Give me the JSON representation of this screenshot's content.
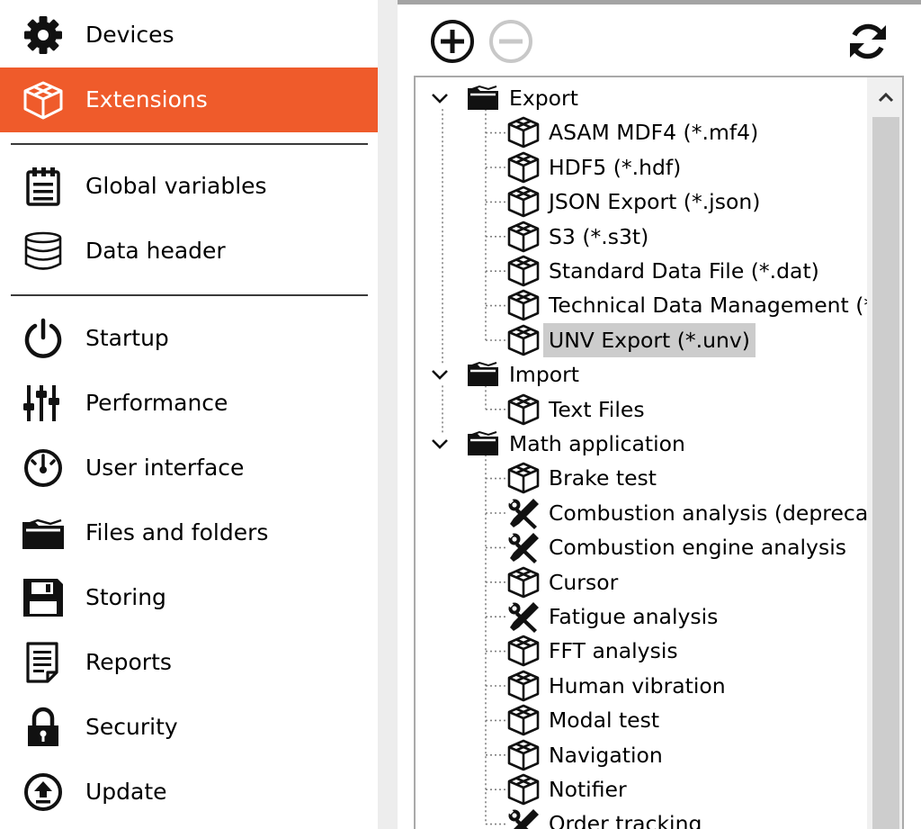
{
  "sidebar": {
    "items": [
      {
        "label": "Devices",
        "icon": "gear-icon"
      },
      {
        "label": "Extensions",
        "icon": "package-icon",
        "active": true
      },
      {
        "label": "Global variables",
        "icon": "clipboard-icon"
      },
      {
        "label": "Data header",
        "icon": "database-icon"
      },
      {
        "label": "Startup",
        "icon": "power-icon"
      },
      {
        "label": "Performance",
        "icon": "sliders-icon"
      },
      {
        "label": "User interface",
        "icon": "gauge-icon"
      },
      {
        "label": "Files and folders",
        "icon": "folder-icon"
      },
      {
        "label": "Storing",
        "icon": "floppy-icon"
      },
      {
        "label": "Reports",
        "icon": "document-icon"
      },
      {
        "label": "Security",
        "icon": "lock-icon"
      },
      {
        "label": "Update",
        "icon": "upload-icon"
      }
    ],
    "active_color": "#ef5b2b"
  },
  "toolbar": {
    "add_icon": "plus-circle-icon",
    "remove_icon": "minus-circle-icon",
    "remove_enabled": false,
    "refresh_icon": "refresh-icon"
  },
  "tree": {
    "groups": [
      {
        "label": "Export",
        "expanded": true,
        "children": [
          {
            "label": "ASAM MDF4 (*.mf4)",
            "icon": "package-icon"
          },
          {
            "label": "HDF5 (*.hdf)",
            "icon": "package-icon"
          },
          {
            "label": "JSON Export (*.json)",
            "icon": "package-icon"
          },
          {
            "label": "S3 (*.s3t)",
            "icon": "package-icon"
          },
          {
            "label": "Standard Data File (*.dat)",
            "icon": "package-icon"
          },
          {
            "label": "Technical Data Management (*",
            "icon": "package-icon"
          },
          {
            "label": "UNV Export (*.unv)",
            "icon": "package-icon",
            "selected": true
          }
        ]
      },
      {
        "label": "Import",
        "expanded": true,
        "children": [
          {
            "label": "Text Files",
            "icon": "package-icon"
          }
        ]
      },
      {
        "label": "Math application",
        "expanded": true,
        "children": [
          {
            "label": "Brake test",
            "icon": "package-icon"
          },
          {
            "label": "Combustion analysis (deprecat",
            "icon": "tools-icon"
          },
          {
            "label": "Combustion engine analysis",
            "icon": "tools-icon"
          },
          {
            "label": "Cursor",
            "icon": "package-icon"
          },
          {
            "label": "Fatigue analysis",
            "icon": "tools-icon"
          },
          {
            "label": "FFT analysis",
            "icon": "package-icon"
          },
          {
            "label": "Human vibration",
            "icon": "package-icon"
          },
          {
            "label": "Modal test",
            "icon": "package-icon"
          },
          {
            "label": "Navigation",
            "icon": "package-icon"
          },
          {
            "label": "Notifier",
            "icon": "package-icon"
          },
          {
            "label": "Order tracking",
            "icon": "tools-icon"
          }
        ]
      }
    ]
  }
}
